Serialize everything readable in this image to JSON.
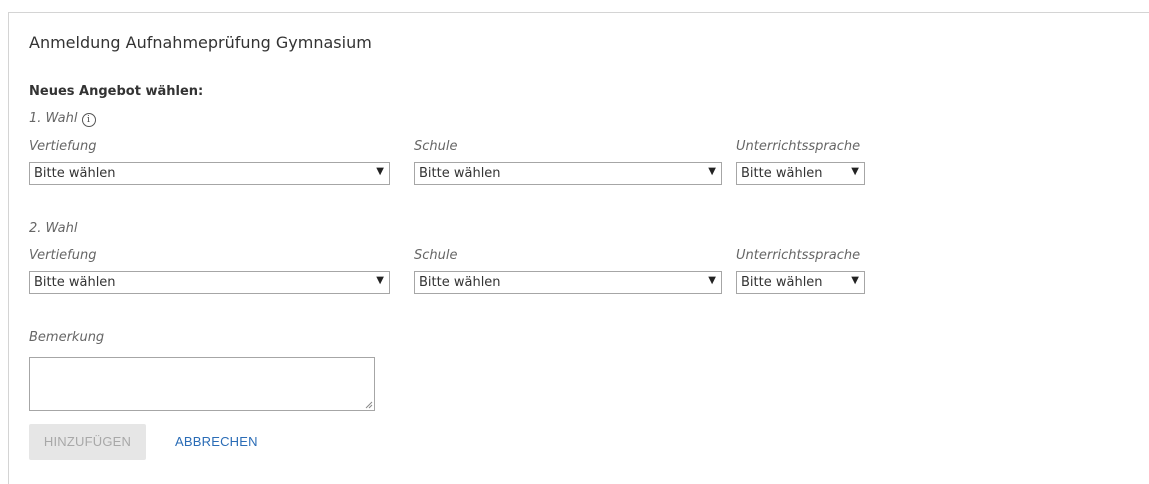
{
  "form": {
    "title": "Anmeldung Aufnahmeprüfung Gymnasium",
    "section_heading": "Neues Angebot wählen:",
    "choice1": {
      "label": "1. Wahl",
      "vertiefung_label": "Vertiefung",
      "vertiefung_value": "Bitte wählen",
      "schule_label": "Schule",
      "schule_value": "Bitte wählen",
      "sprache_label": "Unterrichtssprache",
      "sprache_value": "Bitte wählen"
    },
    "choice2": {
      "label": "2. Wahl",
      "vertiefung_label": "Vertiefung",
      "vertiefung_value": "Bitte wählen",
      "schule_label": "Schule",
      "schule_value": "Bitte wählen",
      "sprache_label": "Unterrichtssprache",
      "sprache_value": "Bitte wählen"
    },
    "remark_label": "Bemerkung",
    "remark_value": "",
    "add_label": "HINZUFÜGEN",
    "cancel_label": "ABBRECHEN"
  },
  "icons": {
    "info": "info-icon",
    "caret": "dropdown-caret-icon"
  },
  "colors": {
    "link": "#2a6cb6",
    "disabled_button_bg": "#e6e6e6",
    "disabled_button_text": "#a8a8a8",
    "border": "#a6a6a6"
  }
}
